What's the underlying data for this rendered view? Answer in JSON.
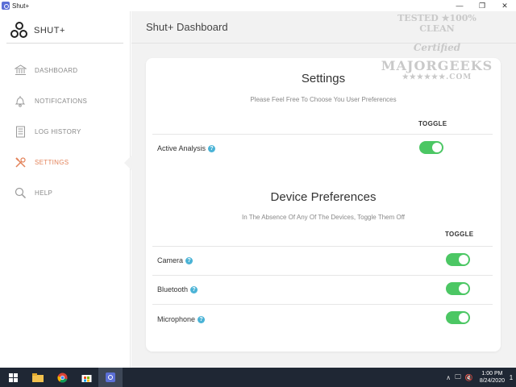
{
  "window": {
    "title": "Shut+",
    "minimize": "—",
    "maximize": "❐",
    "close": "✕"
  },
  "brand": {
    "name": "SHUT+"
  },
  "sidebar": {
    "items": [
      {
        "label": "DASHBOARD",
        "icon": "bank-icon"
      },
      {
        "label": "NOTIFICATIONS",
        "icon": "bell-icon"
      },
      {
        "label": "LOG HISTORY",
        "icon": "document-icon"
      },
      {
        "label": "SETTINGS",
        "icon": "tools-icon"
      },
      {
        "label": "HELP",
        "icon": "search-icon"
      }
    ],
    "active_index": 3
  },
  "header": {
    "title": "Shut+ Dashboard"
  },
  "settings": {
    "title": "Settings",
    "subtitle": "Please Feel Free To Choose You User Preferences",
    "toggle_header": "TOGGLE",
    "rows": [
      {
        "label": "Active Analysis",
        "enabled": true
      }
    ]
  },
  "devices": {
    "title": "Device Preferences",
    "subtitle": "In The Absence Of Any Of The Devices, Toggle Them Off",
    "toggle_header": "TOGGLE",
    "rows": [
      {
        "label": "Camera",
        "enabled": true
      },
      {
        "label": "Bluetooth",
        "enabled": true
      },
      {
        "label": "Microphone",
        "enabled": true
      }
    ]
  },
  "help_glyph": "?",
  "watermark": {
    "line1": "TESTED ★100% CLEAN",
    "line2": "Certified",
    "line3": "MAJORGEEKS",
    "line4": "★★★★★★.COM"
  },
  "taskbar": {
    "time": "1:00 PM",
    "date": "8/24/2020",
    "notification_count": "1"
  },
  "colors": {
    "accent_active": "#e3835a",
    "toggle_on": "#4cc764",
    "help_icon": "#4ab3d6",
    "taskbar": "#1f2734"
  }
}
